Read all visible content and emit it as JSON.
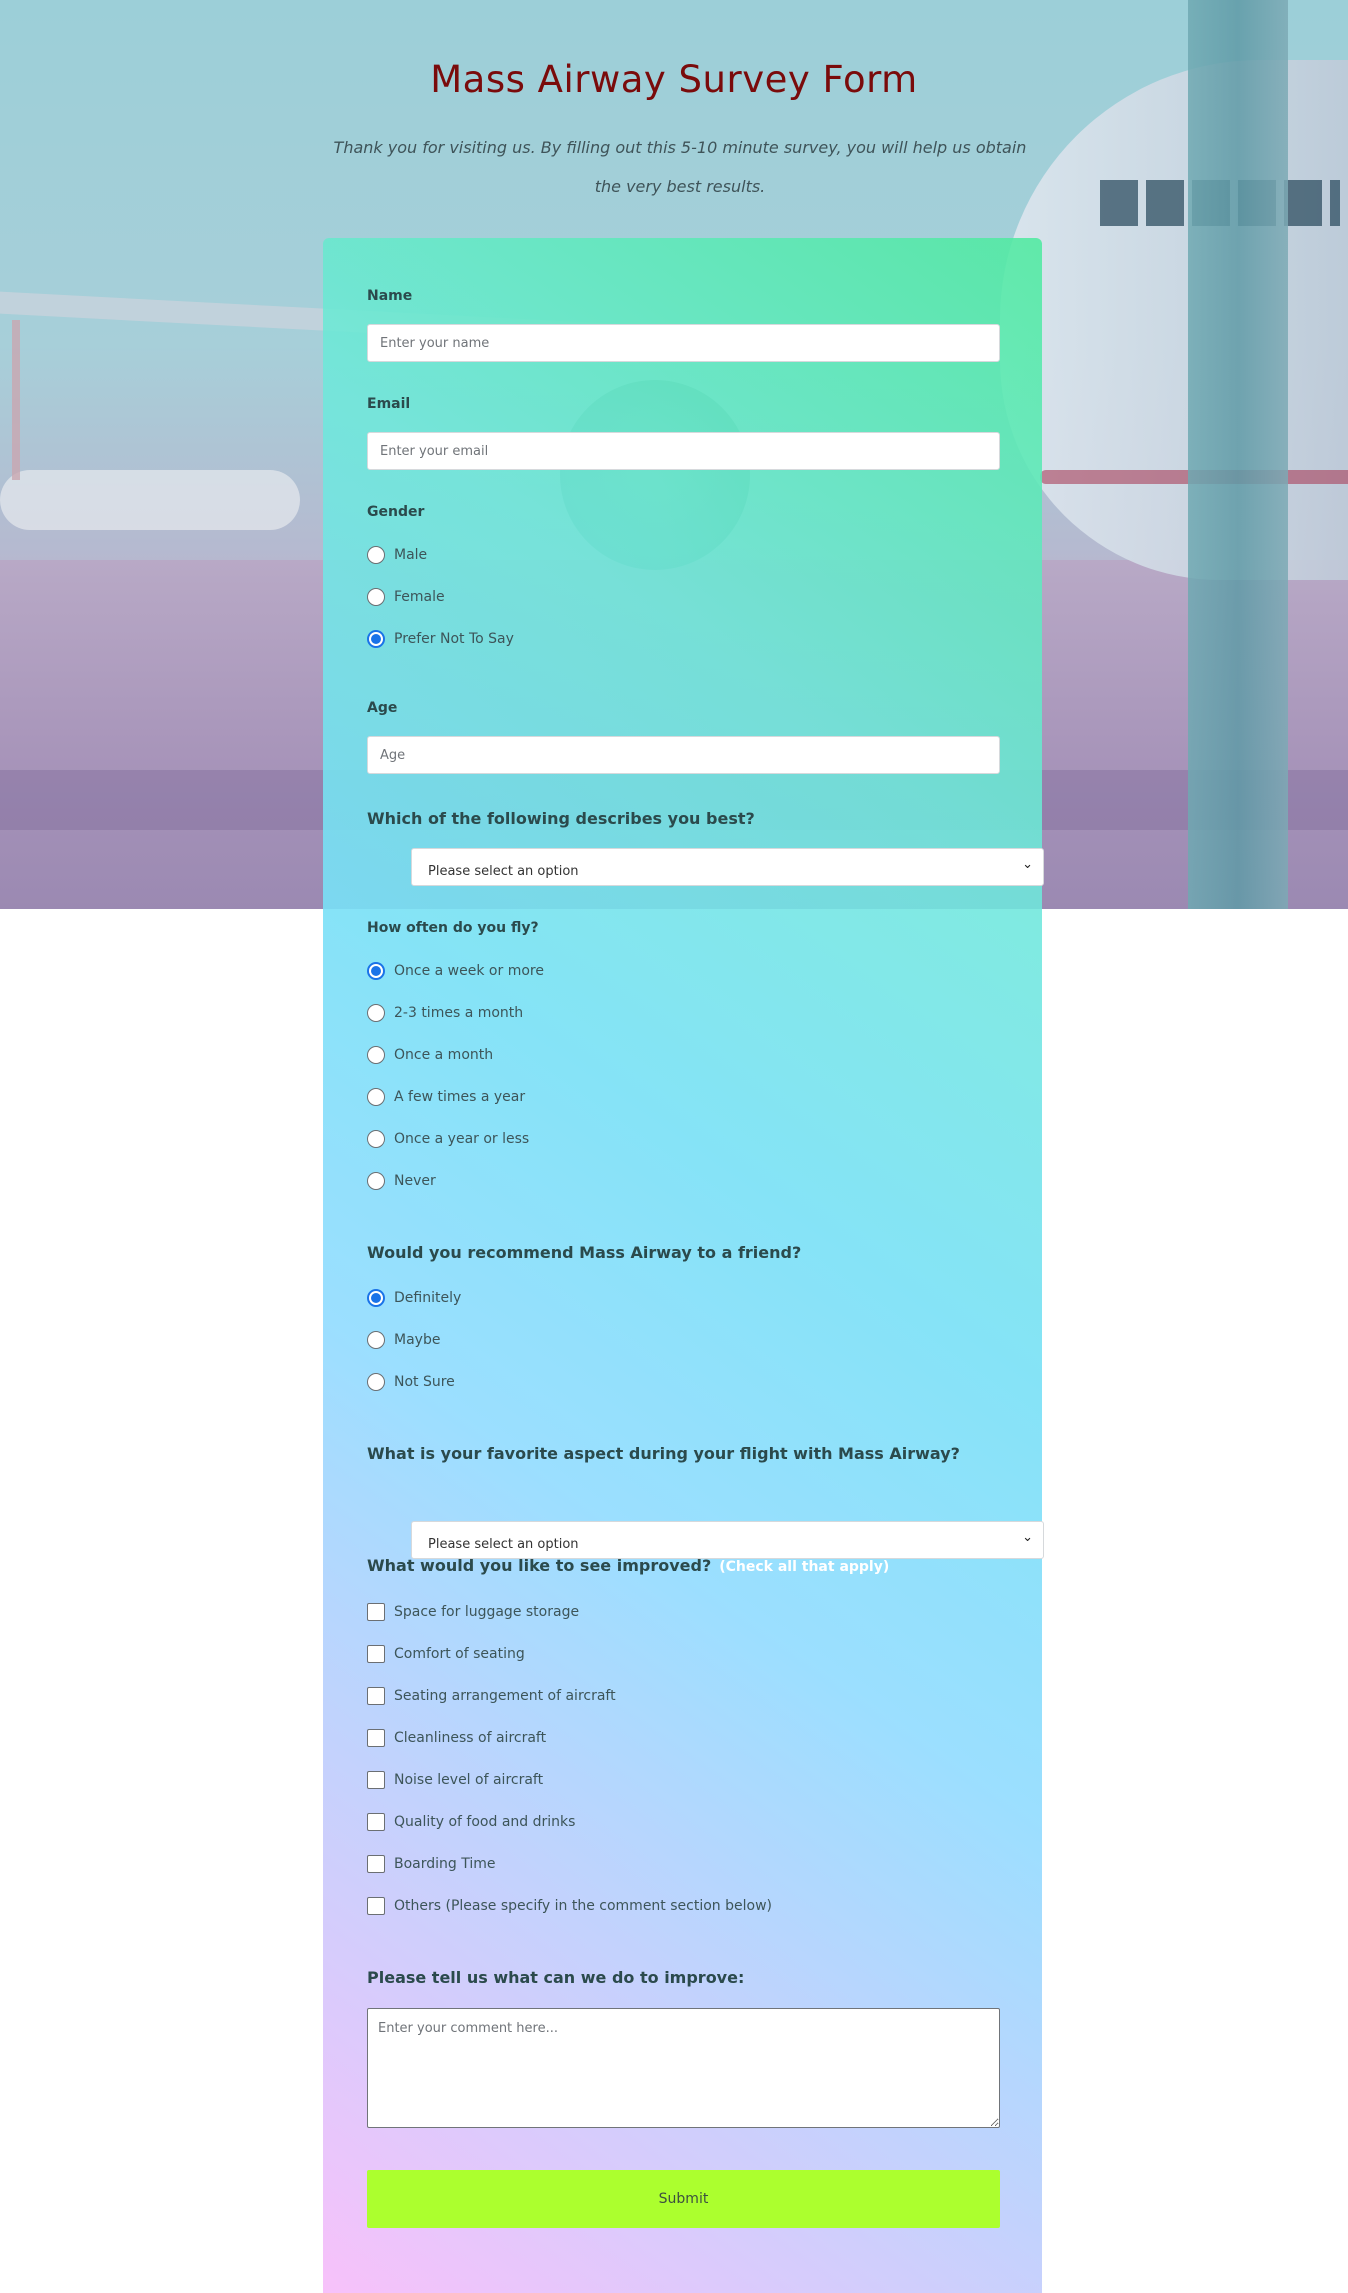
{
  "header": {
    "title": "Mass Airway Survey Form",
    "subtitle": "Thank you for visiting us. By filling out this 5-10 minute survey, you will help us obtain the very best results."
  },
  "form": {
    "name": {
      "label": "Name",
      "placeholder": "Enter your name",
      "value": ""
    },
    "email": {
      "label": "Email",
      "placeholder": "Enter your email",
      "value": ""
    },
    "gender": {
      "label": "Gender",
      "options": [
        "Male",
        "Female",
        "Prefer Not To Say"
      ],
      "selected": "Prefer Not To Say"
    },
    "age": {
      "label": "Age",
      "placeholder": "Age",
      "value": ""
    },
    "describes": {
      "label": "Which of the following describes you best?",
      "selected": "Please select an option"
    },
    "fly_frequency": {
      "label": "How often do you fly?",
      "options": [
        "Once a week or more",
        "2-3 times a month",
        "Once a month",
        "A few times a year",
        "Once a year or less",
        "Never"
      ],
      "selected": "Once a week or more"
    },
    "recommend": {
      "label": "Would you recommend Mass Airway to a friend?",
      "options": [
        "Definitely",
        "Maybe",
        "Not Sure"
      ],
      "selected": "Definitely"
    },
    "favorite": {
      "label": "What is your favorite aspect during your flight with Mass Airway?",
      "selected": "Please select an option"
    },
    "improve": {
      "label": "What would you like to see improved?",
      "hint": "(Check all that apply)",
      "options": [
        "Space for luggage storage",
        "Comfort of seating",
        "Seating arrangement of aircraft",
        "Cleanliness of aircraft",
        "Noise level of aircraft",
        "Quality of food and drinks",
        "Boarding Time",
        "Others (Please specify in the comment section below)"
      ],
      "checked": []
    },
    "comment": {
      "label": "Please tell us what can we do to improve:",
      "placeholder": "Enter your comment here..."
    },
    "submit_label": "Submit"
  },
  "colors": {
    "title": "#7a0b0b",
    "submit_bg": "#acff2e",
    "radio_accent": "#1a73e8"
  }
}
